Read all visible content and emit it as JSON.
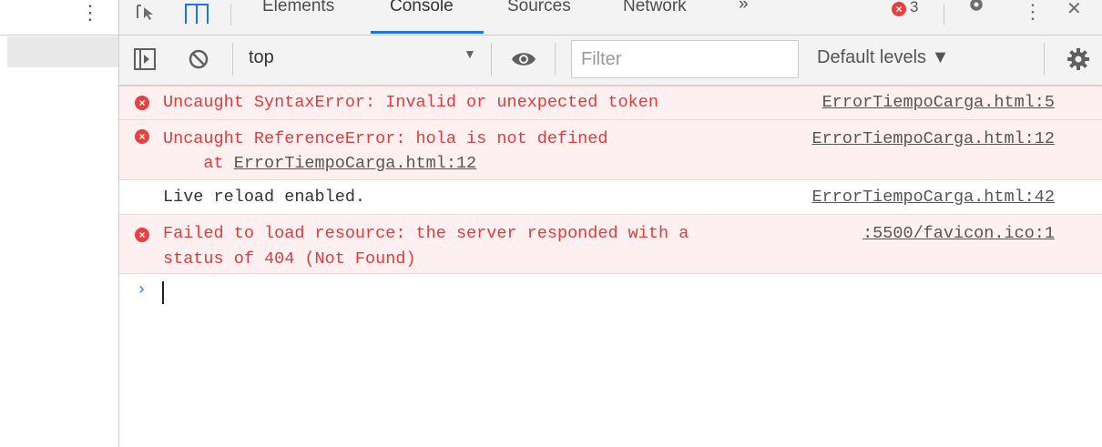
{
  "left_pane": {
    "menu_icon": "vertical-dots-icon"
  },
  "tabs": {
    "items": [
      "Elements",
      "Console",
      "Sources",
      "Network"
    ],
    "active": "Console",
    "overflow_glyph": "»",
    "error_count": "3"
  },
  "toolbar": {
    "context": "top",
    "filter_placeholder": "Filter",
    "levels_label": "Default levels ▼"
  },
  "messages": [
    {
      "type": "error",
      "text": "Uncaught SyntaxError: Invalid or unexpected token",
      "source": "ErrorTiempoCarga.html:5"
    },
    {
      "type": "error",
      "text": "Uncaught ReferenceError: hola is not defined",
      "at_prefix": "    at ",
      "at_link": "ErrorTiempoCarga.html:12",
      "source": "ErrorTiempoCarga.html:12"
    },
    {
      "type": "info",
      "text": "Live reload enabled.",
      "source": "ErrorTiempoCarga.html:42"
    },
    {
      "type": "error",
      "text": "Failed to load resource: the server responded with a",
      "text2": "status of 404 (Not Found)",
      "source": ":5500/favicon.ico:1"
    }
  ],
  "prompt": "›",
  "colors": {
    "error_bg": "#fef0f0",
    "error_text": "#e03b3b",
    "accent": "#1a73e8"
  }
}
